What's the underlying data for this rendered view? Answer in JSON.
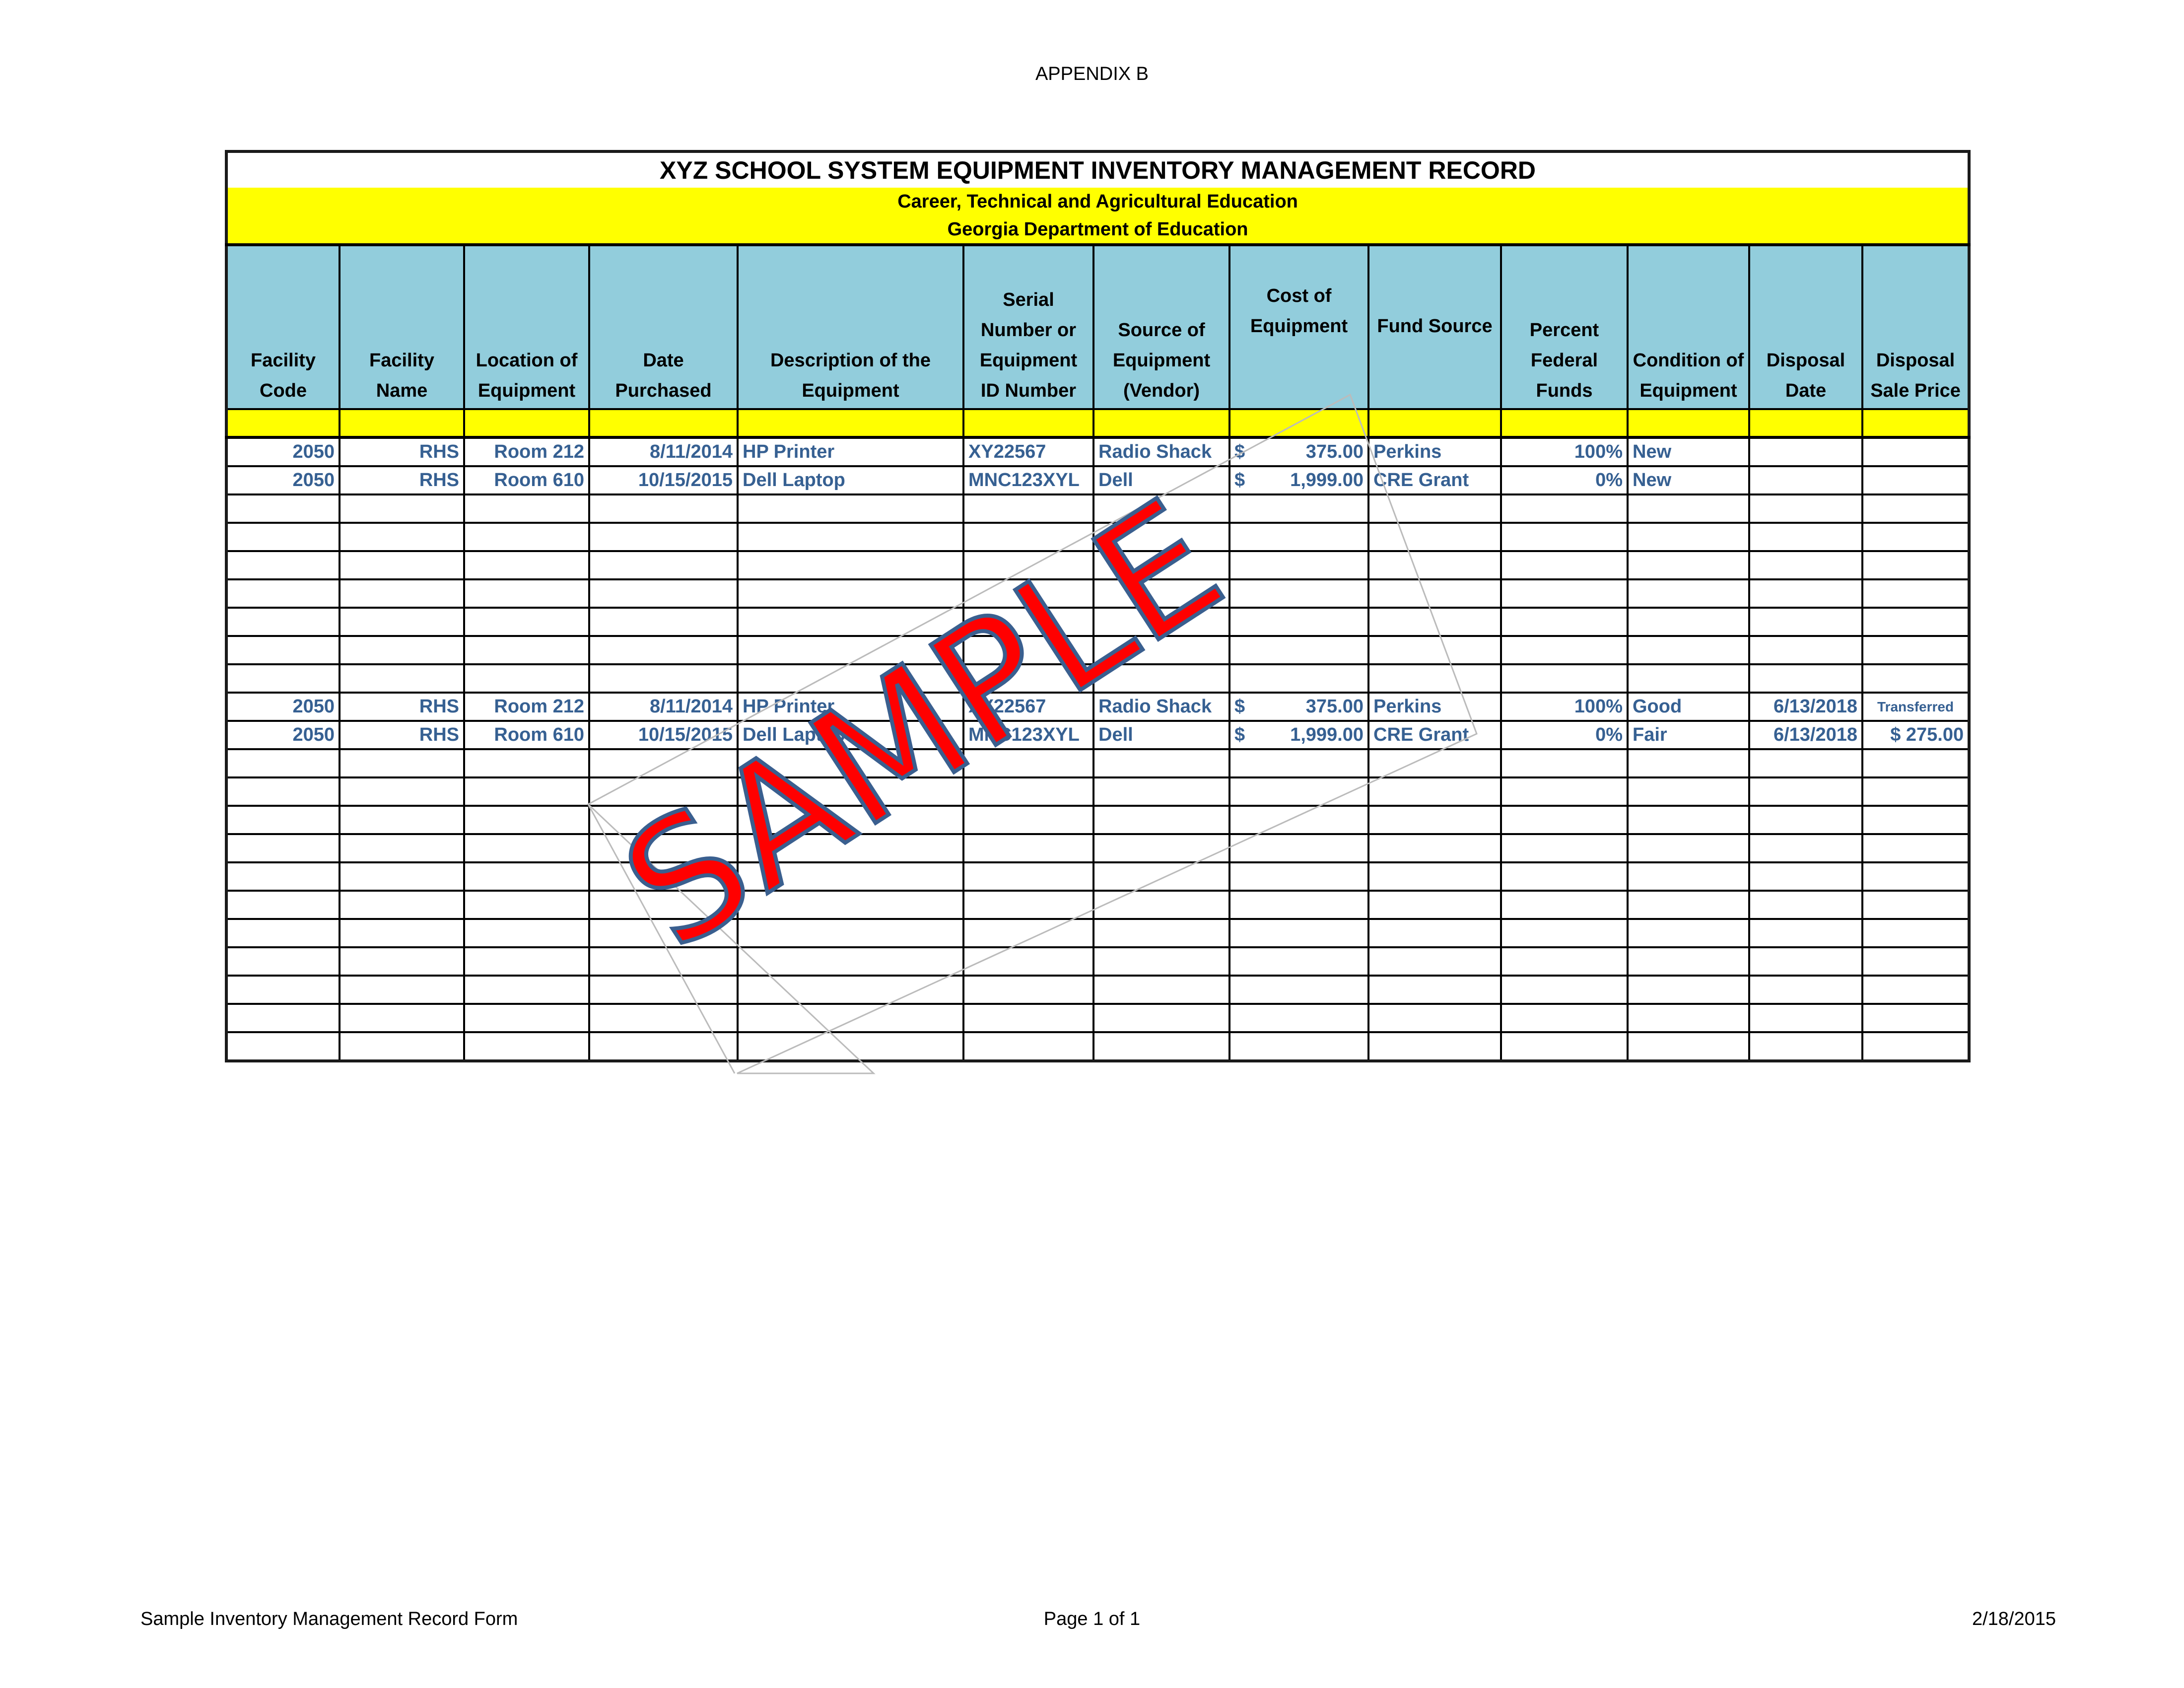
{
  "page_header": "APPENDIX B",
  "form": {
    "title": "XYZ SCHOOL SYSTEM EQUIPMENT INVENTORY MANAGEMENT RECORD",
    "subtitle_1": "Career, Technical and Agricultural Education",
    "subtitle_2": "Georgia Department of Education",
    "columns": [
      "Facility Code",
      "Facility Name",
      "Location of Equipment",
      "Date Purchased",
      "Description of the Equipment",
      "Serial Number or Equipment ID Number",
      "Source of Equipment (Vendor)",
      "Cost of Equipment",
      "Fund Source",
      "Percent Federal Funds",
      "Condition of Equipment",
      "Disposal Date",
      "Disposal Sale Price"
    ],
    "rows": [
      {
        "facility_code": "2050",
        "facility_name": "RHS",
        "location": "Room 212",
        "date_purchased": "8/11/2014",
        "description": "HP Printer",
        "serial": "XY22567",
        "vendor": "Radio Shack",
        "cost_symbol": "$",
        "cost": "375.00",
        "fund_source": "Perkins",
        "percent_federal": "100%",
        "condition": "New",
        "disposal_date": "",
        "disposal_price": ""
      },
      {
        "facility_code": "2050",
        "facility_name": "RHS",
        "location": "Room 610",
        "date_purchased": "10/15/2015",
        "description": "Dell Laptop",
        "serial": "MNC123XYL",
        "vendor": "Dell",
        "cost_symbol": "$",
        "cost": "1,999.00",
        "fund_source": "CRE Grant",
        "percent_federal": "0%",
        "condition": "New",
        "disposal_date": "",
        "disposal_price": ""
      },
      {},
      {},
      {},
      {},
      {},
      {},
      {},
      {
        "facility_code": "2050",
        "facility_name": "RHS",
        "location": "Room 212",
        "date_purchased": "8/11/2014",
        "description": "HP Printer",
        "serial": "XY22567",
        "vendor": "Radio Shack",
        "cost_symbol": "$",
        "cost": "375.00",
        "fund_source": "Perkins",
        "percent_federal": "100%",
        "condition": "Good",
        "disposal_date": "6/13/2018",
        "disposal_price": "Transferred"
      },
      {
        "facility_code": "2050",
        "facility_name": "RHS",
        "location": "Room 610",
        "date_purchased": "10/15/2015",
        "description": "Dell Laptop",
        "serial": "MNC123XYL",
        "vendor": "Dell",
        "cost_symbol": "$",
        "cost": "1,999.00",
        "fund_source": "CRE Grant",
        "percent_federal": "0%",
        "condition": "Fair",
        "disposal_date": "6/13/2018",
        "disposal_price": "$ 275.00"
      },
      {},
      {},
      {},
      {},
      {},
      {},
      {},
      {},
      {},
      {},
      {}
    ]
  },
  "watermark": {
    "text": "SAMPLE",
    "fill_color": "#ff0000",
    "outline_color": "#3a5f8f"
  },
  "footer": {
    "left": "Sample  Inventory Management Record Form",
    "center": "Page 1 of 1",
    "right": "2/18/2015"
  },
  "colors": {
    "header_blue": "#92cddc",
    "highlight_yellow": "#ffff00",
    "data_text": "#366092"
  }
}
